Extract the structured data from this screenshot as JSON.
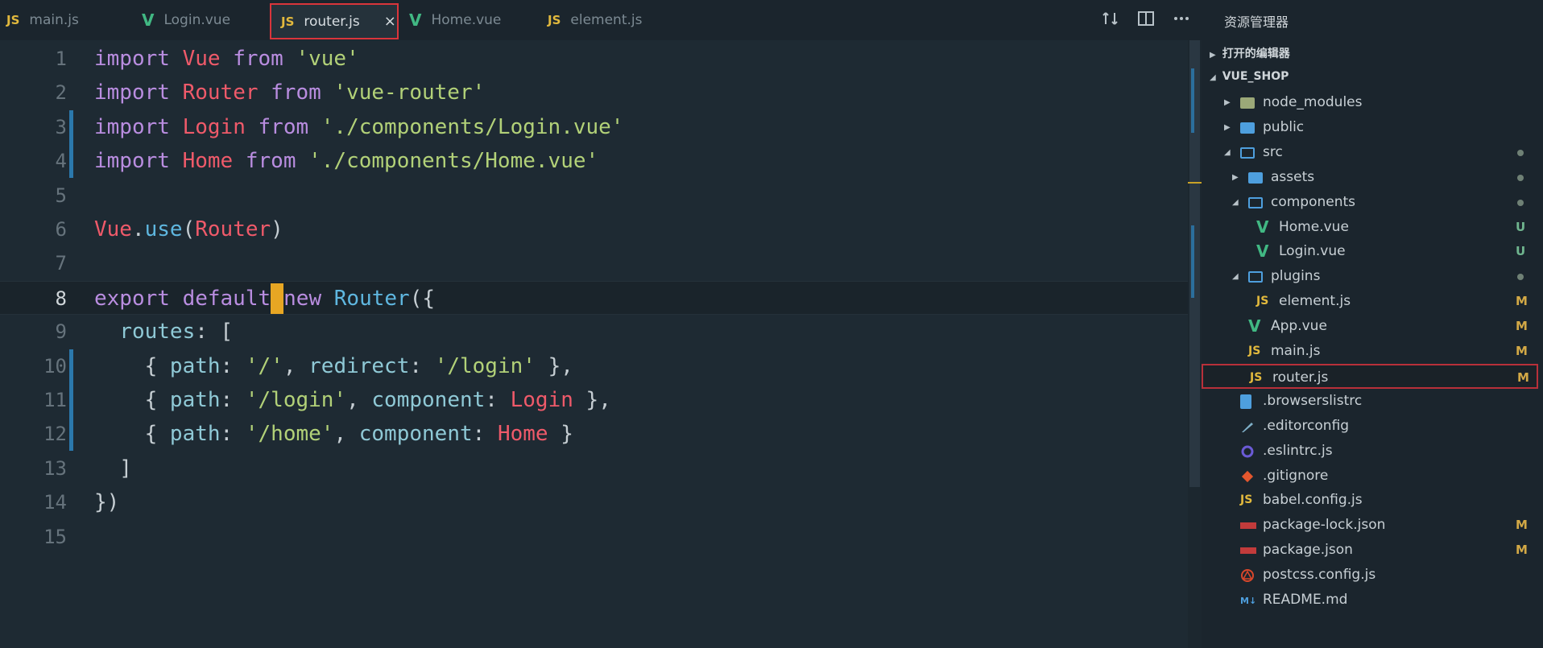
{
  "tabs": [
    {
      "label": "main.js",
      "type": "js",
      "active": false
    },
    {
      "label": "Login.vue",
      "type": "vue",
      "active": false
    },
    {
      "label": "router.js",
      "type": "js",
      "active": true
    },
    {
      "label": "Home.vue",
      "type": "vue",
      "active": false
    },
    {
      "label": "element.js",
      "type": "js",
      "active": false
    }
  ],
  "tab_close_symbol": "×",
  "toolbar_icons": [
    "split-compare-icon",
    "split-editor-icon",
    "more-actions-icon"
  ],
  "explorer": {
    "title": "资源管理器",
    "open_editors_label": "打开的编辑器",
    "project_label": "VUE_SHOP",
    "tree": [
      {
        "label": "node_modules",
        "kind": "folder-nm",
        "depth": 1,
        "twisty": "closed",
        "status": ""
      },
      {
        "label": "public",
        "kind": "folder",
        "depth": 1,
        "twisty": "closed",
        "status": ""
      },
      {
        "label": "src",
        "kind": "folder-open",
        "depth": 1,
        "twisty": "open",
        "status": "dot"
      },
      {
        "label": "assets",
        "kind": "folder",
        "depth": 2,
        "twisty": "closed",
        "status": "dot"
      },
      {
        "label": "components",
        "kind": "folder-open",
        "depth": 2,
        "twisty": "open",
        "status": "dot"
      },
      {
        "label": "Home.vue",
        "kind": "vue",
        "depth": 3,
        "twisty": "",
        "status": "U"
      },
      {
        "label": "Login.vue",
        "kind": "vue",
        "depth": 3,
        "twisty": "",
        "status": "U"
      },
      {
        "label": "plugins",
        "kind": "folder-open",
        "depth": 2,
        "twisty": "open",
        "status": "dot"
      },
      {
        "label": "element.js",
        "kind": "js",
        "depth": 3,
        "twisty": "",
        "status": "M"
      },
      {
        "label": "App.vue",
        "kind": "vue",
        "depth": 2,
        "twisty": "",
        "status": "M"
      },
      {
        "label": "main.js",
        "kind": "js",
        "depth": 2,
        "twisty": "",
        "status": "M"
      },
      {
        "label": "router.js",
        "kind": "js",
        "depth": 2,
        "twisty": "",
        "status": "M",
        "selected": true
      },
      {
        "label": ".browserslistrc",
        "kind": "file",
        "depth": 1,
        "twisty": "",
        "status": ""
      },
      {
        "label": ".editorconfig",
        "kind": "editorconfig",
        "depth": 1,
        "twisty": "",
        "status": ""
      },
      {
        "label": ".eslintrc.js",
        "kind": "eslint",
        "depth": 1,
        "twisty": "",
        "status": ""
      },
      {
        "label": ".gitignore",
        "kind": "git",
        "depth": 1,
        "twisty": "",
        "status": ""
      },
      {
        "label": "babel.config.js",
        "kind": "js",
        "depth": 1,
        "twisty": "",
        "status": ""
      },
      {
        "label": "package-lock.json",
        "kind": "npm",
        "depth": 1,
        "twisty": "",
        "status": "M"
      },
      {
        "label": "package.json",
        "kind": "npm",
        "depth": 1,
        "twisty": "",
        "status": "M"
      },
      {
        "label": "postcss.config.js",
        "kind": "postcss",
        "depth": 1,
        "twisty": "",
        "status": ""
      },
      {
        "label": "README.md",
        "kind": "md",
        "depth": 1,
        "twisty": "",
        "status": ""
      }
    ]
  },
  "editor": {
    "current_line": 8,
    "lines": [
      {
        "n": "1",
        "tokens": [
          [
            "kw",
            "import "
          ],
          [
            "id",
            "Vue"
          ],
          [
            "kw",
            " from "
          ],
          [
            "str",
            "'vue'"
          ]
        ]
      },
      {
        "n": "2",
        "tokens": [
          [
            "kw",
            "import "
          ],
          [
            "id",
            "Router"
          ],
          [
            "kw",
            " from "
          ],
          [
            "str",
            "'vue-router'"
          ]
        ]
      },
      {
        "n": "3",
        "git": true,
        "tokens": [
          [
            "kw",
            "import "
          ],
          [
            "id",
            "Login"
          ],
          [
            "kw",
            " from "
          ],
          [
            "str",
            "'./components/Login.vue'"
          ]
        ]
      },
      {
        "n": "4",
        "git": true,
        "tokens": [
          [
            "kw",
            "import "
          ],
          [
            "id",
            "Home"
          ],
          [
            "kw",
            " from "
          ],
          [
            "str",
            "'./components/Home.vue'"
          ]
        ]
      },
      {
        "n": "5",
        "tokens": []
      },
      {
        "n": "6",
        "tokens": [
          [
            "id",
            "Vue"
          ],
          [
            "pn",
            "."
          ],
          [
            "fn",
            "use"
          ],
          [
            "pn",
            "("
          ],
          [
            "id",
            "Router"
          ],
          [
            "pn",
            ")"
          ]
        ]
      },
      {
        "n": "7",
        "tokens": []
      },
      {
        "n": "8",
        "tokens": [
          [
            "kw",
            "export default"
          ],
          [
            "cursor",
            ""
          ],
          [
            "kw",
            "new "
          ],
          [
            "fn",
            "Router"
          ],
          [
            "pn",
            "({"
          ]
        ]
      },
      {
        "n": "9",
        "tokens": [
          [
            "pn",
            "  "
          ],
          [
            "prop",
            "routes"
          ],
          [
            "pn",
            ": ["
          ]
        ]
      },
      {
        "n": "10",
        "git": true,
        "tokens": [
          [
            "pn",
            "    { "
          ],
          [
            "prop",
            "path"
          ],
          [
            "pn",
            ": "
          ],
          [
            "str",
            "'/'"
          ],
          [
            "pn",
            ", "
          ],
          [
            "prop",
            "redirect"
          ],
          [
            "pn",
            ": "
          ],
          [
            "str",
            "'/login'"
          ],
          [
            "pn",
            " },"
          ]
        ]
      },
      {
        "n": "11",
        "git": true,
        "tokens": [
          [
            "pn",
            "    { "
          ],
          [
            "prop",
            "path"
          ],
          [
            "pn",
            ": "
          ],
          [
            "str",
            "'/login'"
          ],
          [
            "pn",
            ", "
          ],
          [
            "prop",
            "component"
          ],
          [
            "pn",
            ": "
          ],
          [
            "id",
            "Login"
          ],
          [
            "pn",
            " },"
          ]
        ]
      },
      {
        "n": "12",
        "git": true,
        "tokens": [
          [
            "pn",
            "    { "
          ],
          [
            "prop",
            "path"
          ],
          [
            "pn",
            ": "
          ],
          [
            "str",
            "'/home'"
          ],
          [
            "pn",
            ", "
          ],
          [
            "prop",
            "component"
          ],
          [
            "pn",
            ": "
          ],
          [
            "id",
            "Home"
          ],
          [
            "pn",
            " }"
          ]
        ]
      },
      {
        "n": "13",
        "tokens": [
          [
            "pn",
            "  ]"
          ]
        ]
      },
      {
        "n": "14",
        "tokens": [
          [
            "pn",
            "})"
          ]
        ]
      },
      {
        "n": "15",
        "tokens": []
      }
    ]
  }
}
